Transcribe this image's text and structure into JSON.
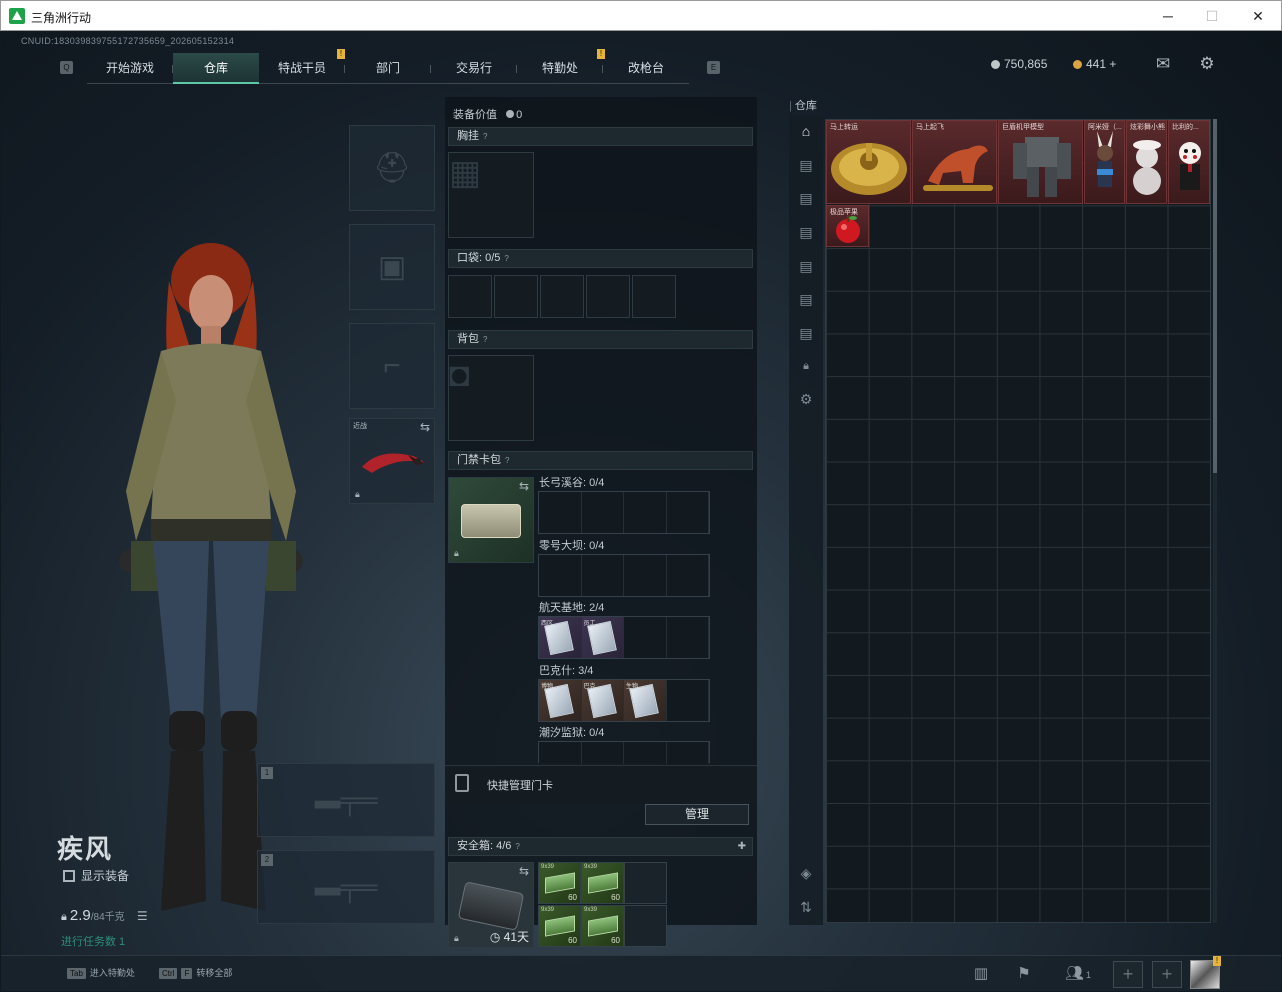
{
  "window": {
    "title": "三角洲行动"
  },
  "header": {
    "cnuid": "CNUID:18303983975517273565​9_202605152314",
    "tabs": [
      "开始游戏",
      "仓库",
      "特战干员",
      "部门",
      "交易行",
      "特勤处",
      "改枪台"
    ],
    "active_tab": "仓库",
    "currency_1": "750,865",
    "currency_2": "441 +"
  },
  "character": {
    "name": "疾风",
    "show_gear_label": "显示装备",
    "weight": "2.9",
    "weight_max": "/84千克",
    "task": "进行任务数 1"
  },
  "gear": {
    "melee_label": "近战"
  },
  "loadout": {
    "equip_value_label": "装备价值",
    "equip_value": "0",
    "chest_rig_label": "胸挂",
    "pocket_label": "口袋:",
    "pocket_value": "0/5",
    "backpack_label": "背包",
    "keycard_label": "门禁卡包",
    "keycard_maps": [
      {
        "label": "长弓溪谷: 0/4"
      },
      {
        "label": "零号大坝: 0/4"
      },
      {
        "label": "航天基地: 2/4",
        "cards": [
          "西区...",
          "员工..."
        ]
      },
      {
        "label": "巴克什: 3/4",
        "cards": [
          "博物...",
          "巴克...",
          "生物..."
        ]
      },
      {
        "label": "潮汐监狱: 0/4"
      }
    ],
    "quick_manage_label": "快捷管理门卡",
    "manage_button": "管理",
    "safe_label": "安全箱:",
    "safe_value": "4/6",
    "safe_timer": "41天",
    "ammo": [
      {
        "name": "9x39",
        "count": "60"
      },
      {
        "name": "9x39",
        "count": "60"
      },
      {
        "name": "9x39",
        "count": "60"
      },
      {
        "name": "9x39",
        "count": "60"
      }
    ]
  },
  "stash": {
    "title": "仓库",
    "items": [
      {
        "name": "马上转运"
      },
      {
        "name": "马上起飞"
      },
      {
        "name": "巨盾机甲模型"
      },
      {
        "name": "阿米娅（..."
      },
      {
        "name": "炫彩舞小熊"
      },
      {
        "name": "比利的..."
      },
      {
        "name": "极品苹果"
      }
    ]
  },
  "bottom": {
    "hint_1_key": "Tab",
    "hint_1": "进入特勤处",
    "hint_2_key": "Ctrl",
    "hint_2_key2": "F",
    "hint_2": "转移全部",
    "friends_count": "1"
  }
}
